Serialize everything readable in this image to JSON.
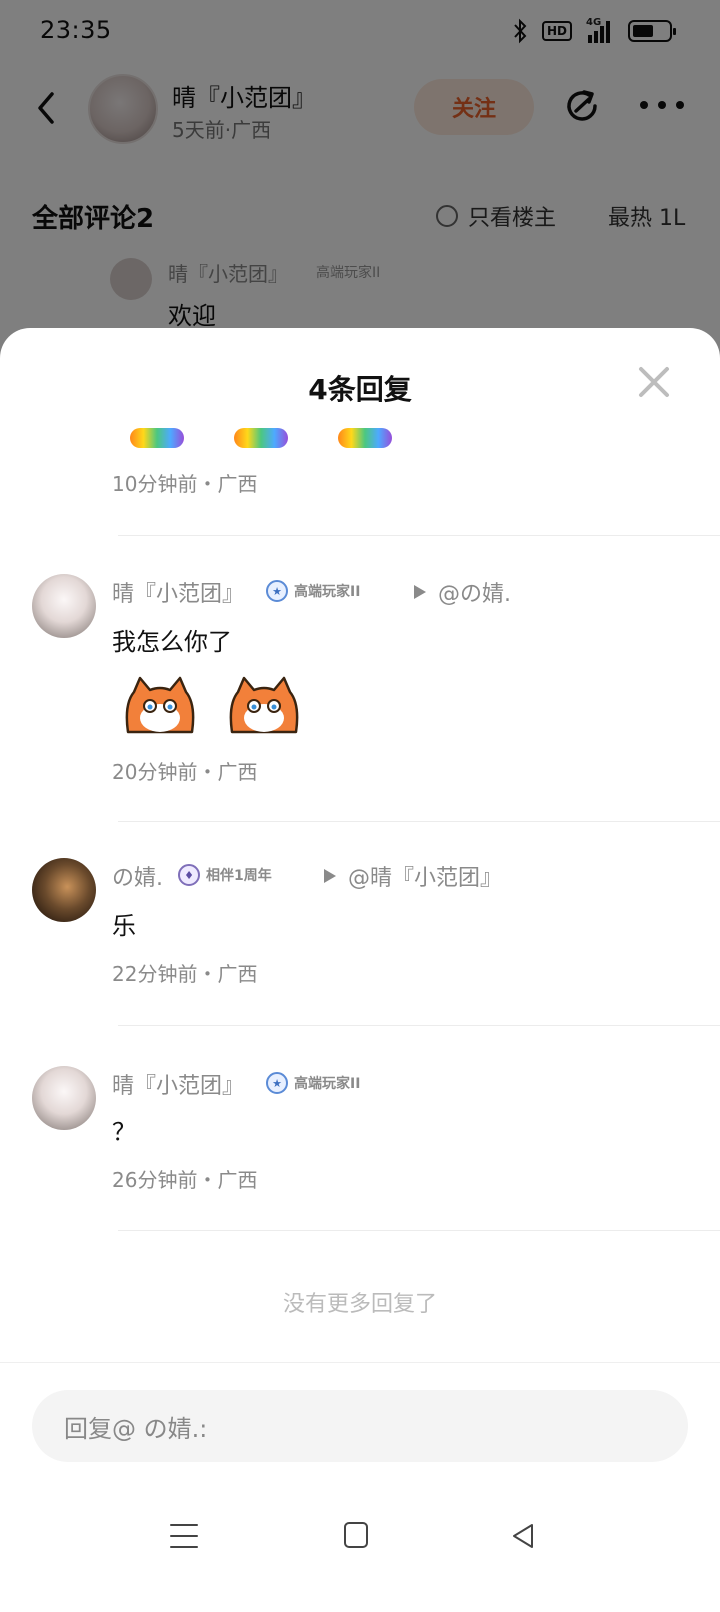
{
  "status_bar": {
    "time": "23:35",
    "hd_label": "HD",
    "network_label": "4G",
    "icons": [
      "bluetooth-icon",
      "hd-icon",
      "signal-icon",
      "battery-icon"
    ]
  },
  "post_header": {
    "author_name": "晴『小范团』",
    "author_meta": "5天前·广西",
    "follow_label": "关注"
  },
  "comments_bar": {
    "title": "全部评论2",
    "op_only_label": "只看楼主",
    "sort_label": "最热 1L"
  },
  "background_comment": {
    "username": "晴『小范团』",
    "badge": "高端玩家II",
    "text": "欢迎"
  },
  "sheet": {
    "title": "4条回复",
    "first_reply_time": "10分钟前・广西",
    "replies": [
      {
        "username": "晴『小范团』",
        "badge": "高端玩家II",
        "reply_to": "@の婧.",
        "text": "我怎么你了",
        "time": "20分钟前・广西"
      },
      {
        "username": "の婧.",
        "badge": "相伴1周年",
        "reply_to": "@晴『小范团』",
        "text": "乐",
        "time": "22分钟前・广西"
      },
      {
        "username": "晴『小范团』",
        "badge": "高端玩家II",
        "text": "？",
        "time": "26分钟前・广西"
      }
    ],
    "no_more": "没有更多回复了",
    "input_placeholder": "回复@ の婧.:"
  },
  "colors": {
    "accent": "#e8602a",
    "follow_bg": "#fde9dd",
    "muted_text": "#8a8a8a"
  }
}
